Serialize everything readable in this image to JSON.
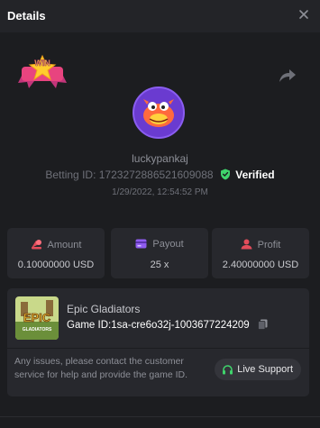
{
  "header": {
    "title": "Details"
  },
  "badge": {
    "text": "WIN"
  },
  "user": {
    "username": "luckypankaj"
  },
  "bet": {
    "id_label": "Betting ID:",
    "id": "1723272886521609088",
    "verified": "Verified",
    "date": "1/29/2022, 12:54:52 PM"
  },
  "stats": {
    "amount": {
      "label": "Amount",
      "value": "0.10000000 USD"
    },
    "payout": {
      "label": "Payout",
      "value": "25 x"
    },
    "profit": {
      "label": "Profit",
      "value": "2.40000000 USD"
    }
  },
  "game": {
    "name": "Epic Gladiators",
    "thumb_text": "EPIC",
    "thumb_sub": "GLADIATORS",
    "id_label": "Game ID:",
    "id": "1sa-cre6o32j-1003677224209"
  },
  "support": {
    "message": "Any issues, please contact the customer service for help and provide the game ID.",
    "button": "Live Support"
  },
  "colors": {
    "accent": "#3fd46c",
    "amount": "#e24c5a",
    "payout": "#8f5cf0",
    "profit": "#e24c5a",
    "background": "#1c1d20",
    "card": "#27282d"
  }
}
